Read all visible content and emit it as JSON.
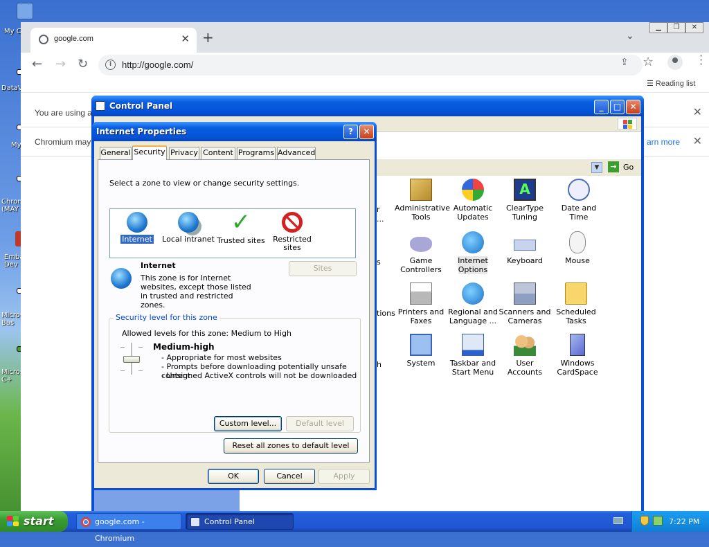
{
  "desktop": {
    "icons": [
      "My C",
      "DataV",
      "My",
      "Chron (MAY",
      "Emba Dev",
      "Micros Bas",
      "Micros C+"
    ]
  },
  "chromium": {
    "tab_title": "google.com",
    "url": "http://google.com/",
    "reading_list": "Reading list",
    "infobar1": "You are using a",
    "infobar2": "Chromium may",
    "learn_more": "arn more"
  },
  "control_panel": {
    "title": "Control Panel",
    "go_label": "Go",
    "partial_labels": [
      "r",
      "...",
      "s",
      "tions",
      "h"
    ],
    "items": [
      {
        "label": "Administrative Tools",
        "icon": "administrative-tools-icon"
      },
      {
        "label": "Automatic Updates",
        "icon": "automatic-updates-icon"
      },
      {
        "label": "ClearType Tuning",
        "icon": "cleartype-tuning-icon"
      },
      {
        "label": "Date and Time",
        "icon": "date-time-icon"
      },
      {
        "label": "Game Controllers",
        "icon": "game-controllers-icon"
      },
      {
        "label": "Internet Options",
        "icon": "internet-options-icon"
      },
      {
        "label": "Keyboard",
        "icon": "keyboard-icon"
      },
      {
        "label": "Mouse",
        "icon": "mouse-icon"
      },
      {
        "label": "Printers and Faxes",
        "icon": "printers-faxes-icon"
      },
      {
        "label": "Regional and Language ...",
        "icon": "regional-language-icon"
      },
      {
        "label": "Scanners and Cameras",
        "icon": "scanners-cameras-icon"
      },
      {
        "label": "Scheduled Tasks",
        "icon": "scheduled-tasks-icon"
      },
      {
        "label": "System",
        "icon": "system-icon"
      },
      {
        "label": "Taskbar and Start Menu",
        "icon": "taskbar-start-menu-icon"
      },
      {
        "label": "User Accounts",
        "icon": "user-accounts-icon"
      },
      {
        "label": "Windows CardSpace",
        "icon": "windows-cardspace-icon"
      }
    ]
  },
  "internet_properties": {
    "title": "Internet Properties",
    "help": "?",
    "tabs": [
      "General",
      "Security",
      "Privacy",
      "Content",
      "Programs",
      "Advanced"
    ],
    "selected_tab": "Security",
    "zone_prompt": "Select a zone to view or change security settings.",
    "zones": [
      {
        "label": "Internet",
        "icon": "internet-globe-icon"
      },
      {
        "label": "Local intranet",
        "icon": "local-intranet-icon"
      },
      {
        "label": "Trusted sites",
        "icon": "trusted-sites-checkmark-icon"
      },
      {
        "label": "Restricted sites",
        "icon": "restricted-sites-icon"
      }
    ],
    "zone_name": "Internet",
    "zone_desc": "This zone is for Internet websites, except those listed in trusted and restricted zones.",
    "sites_button": "Sites",
    "security_group_label": "Security level for this zone",
    "allowed_levels": "Allowed levels for this zone: Medium to High",
    "level_name": "Medium-high",
    "level_points": [
      "- Appropriate for most websites",
      "- Prompts before downloading potentially unsafe content",
      "- Unsigned ActiveX controls will not be downloaded"
    ],
    "custom_level": "Custom level...",
    "default_level": "Default level",
    "reset_all": "Reset all zones to default level",
    "ok": "OK",
    "cancel": "Cancel",
    "apply": "Apply"
  },
  "taskbar": {
    "start": "start",
    "tasks": [
      "google.com - Chromium",
      "Control Panel"
    ],
    "clock": "7:22 PM"
  }
}
